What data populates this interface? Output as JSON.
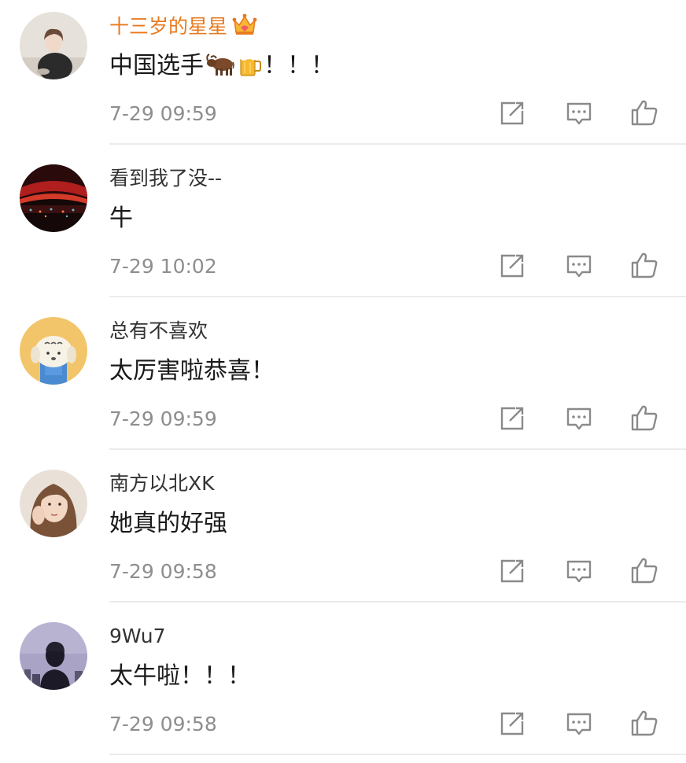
{
  "comments": [
    {
      "username": "十三岁的星星",
      "vip": true,
      "vip_badge_icon": "crown-icon",
      "text": "中国选手",
      "text_emojis": [
        "ox-emoji",
        "beer-mug-emoji"
      ],
      "text_suffix": "！！！",
      "time": "7-29 09:59"
    },
    {
      "username": "看到我了没--",
      "vip": false,
      "text": "牛",
      "time": "7-29 10:02"
    },
    {
      "username": "总有不喜欢",
      "vip": false,
      "text": "太厉害啦恭喜！",
      "time": "7-29 09:59"
    },
    {
      "username": "南方以北XK",
      "vip": false,
      "text": "她真的好强",
      "time": "7-29 09:58"
    },
    {
      "username": "9Wu7",
      "vip": false,
      "text": "太牛啦！！！",
      "time": "7-29 09:58"
    }
  ],
  "action_icons": [
    "share-icon",
    "reply-icon",
    "like-icon"
  ],
  "colors": {
    "vip_name": "#e8791e",
    "username": "#333333",
    "text": "#1a1a1a",
    "time": "#8e8e8e",
    "icon": "#8a8a8a",
    "divider": "#ebebeb"
  }
}
